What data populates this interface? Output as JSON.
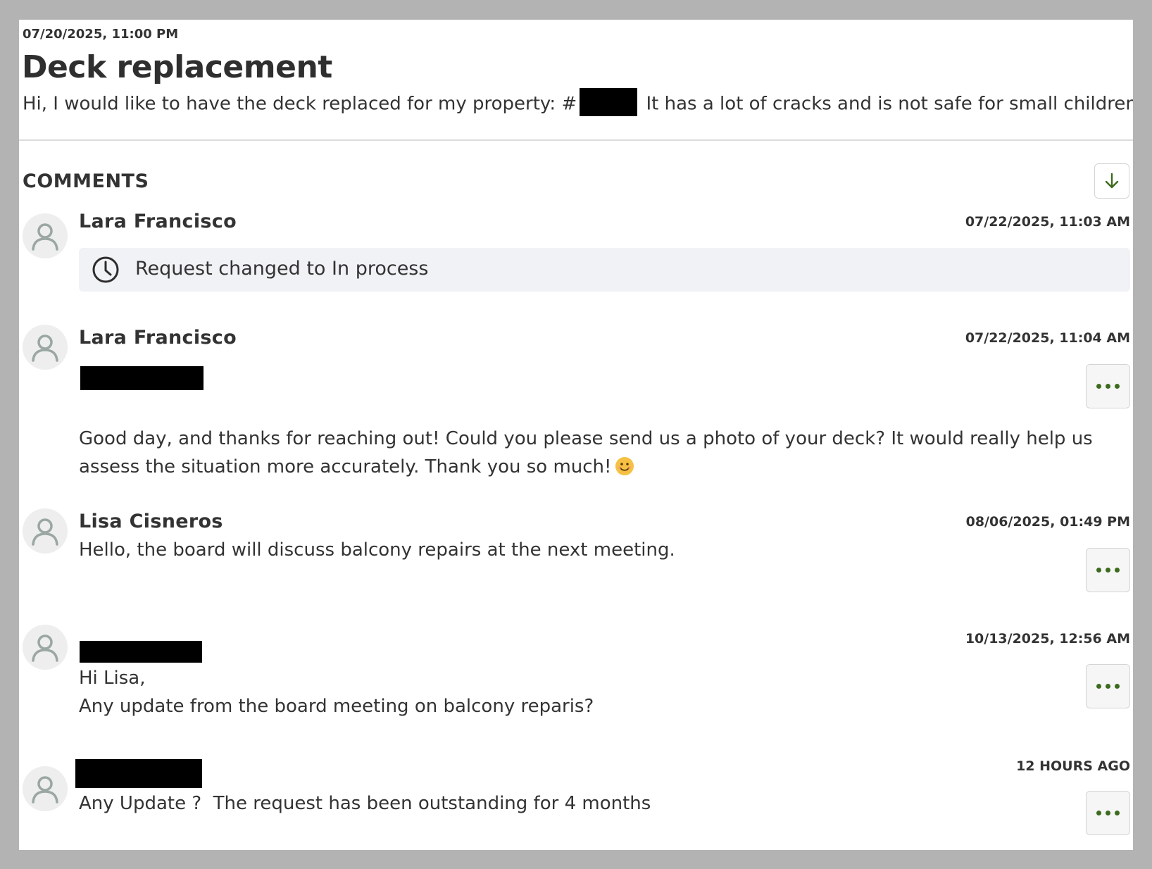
{
  "request": {
    "date": "07/20/2025, 11:00 PM",
    "title": "Deck replacement",
    "description_before": "Hi, I would like to have the deck replaced for my property: #",
    "description_after": " It has a lot of cracks and is not safe for small children."
  },
  "comments_section": {
    "heading": "COMMENTS",
    "sort_icon": "arrow-down-icon",
    "more_icon": "ellipsis-icon",
    "avatar_icon": "user-icon",
    "accent_color": "#3d6b1e"
  },
  "comments": [
    {
      "author": "Lara Francisco",
      "timestamp": "07/22/2025, 11:03 AM",
      "status_icon": "clock-icon",
      "status_text": "Request changed to In process"
    },
    {
      "author": "Lara Francisco",
      "timestamp": "07/22/2025, 11:04 AM",
      "line1": "Good day, and thanks for reaching out! Could you please send us a photo of your deck? It would really help us",
      "line2": "assess the situation more accurately. Thank you so much!",
      "emoji": "smiling-face-emoji"
    },
    {
      "author": "Lisa Cisneros",
      "timestamp": "08/06/2025, 01:49 PM",
      "line1": "Hello, the board will discuss balcony repairs at the next meeting."
    },
    {
      "author": "",
      "timestamp": "10/13/2025, 12:56 AM",
      "line1": "Hi Lisa,",
      "line2": "Any update from the board meeting on balcony reparis?"
    },
    {
      "author": "",
      "timestamp": "12 HOURS AGO",
      "line1": "Any Update ?  The request has been outstanding for 4 months"
    }
  ]
}
